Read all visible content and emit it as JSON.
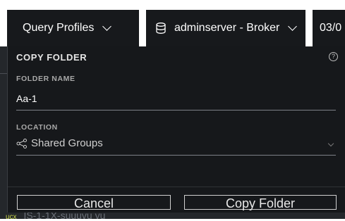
{
  "topbar": {
    "query_profiles_label": "Query Profiles",
    "server_label": "adminserver - Broker",
    "date_label": "03/0"
  },
  "dialog": {
    "title": "COPY FOLDER",
    "help_glyph": "?",
    "folder_name_label": "FOLDER NAME",
    "folder_name_value": "Aa-1",
    "location_label": "LOCATION",
    "location_value": "Shared Groups",
    "cancel_label": "Cancel",
    "copy_label": "Copy Folder"
  },
  "background": {
    "ghost_tag": "ucx",
    "ghost_text": "IS-1-1X-suuuvu vu",
    "right_glyph": "\\"
  },
  "colors": {
    "dialog_bg": "#16181b",
    "topbar_button_bg": "#17191c",
    "text": "#ffffff"
  },
  "icons": [
    "chevron-down-icon",
    "database-icon",
    "help-icon",
    "share-icon"
  ]
}
